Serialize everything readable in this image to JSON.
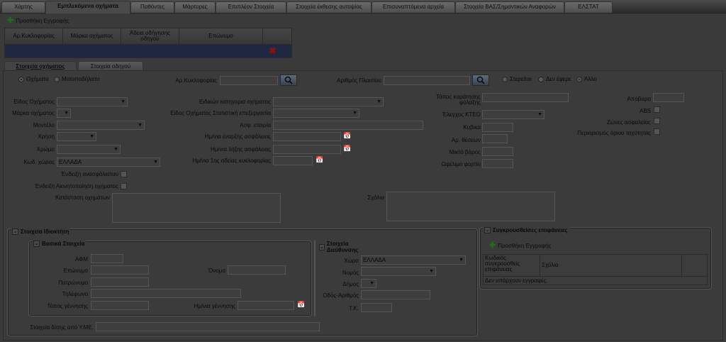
{
  "top_tabs": [
    {
      "label": "Χάρτης"
    },
    {
      "label": "Εμπλεκόμενα οχήματα"
    },
    {
      "label": "Παθόντες"
    },
    {
      "label": "Μάρτυρες"
    },
    {
      "label": "Επιπλέον Στοιχεία"
    },
    {
      "label": "Στοιχεία έκθεσης αυτοψίας"
    },
    {
      "label": "Επισυναπτόμενα αρχεία"
    },
    {
      "label": "Στοιχεία ΒΑΣ/Σημαντικών Αναφορών"
    },
    {
      "label": "ΕΛΣΤΑΤ"
    }
  ],
  "add_record_label": "Προσθήκη Εγγραφής",
  "grid": {
    "headers": [
      "Αρ.Κυκλοφορίας",
      "Μάρκα οχήματος",
      "Άδεια οδήγησης οδηγού",
      "Επώνυμο",
      ""
    ],
    "delete_icon": "✖"
  },
  "sub_tabs": [
    {
      "label": "Στοιχεία οχήματος"
    },
    {
      "label": "Στοιχεία οδηγού"
    }
  ],
  "vehicle_type": {
    "option1": "Οχήματα",
    "option2": "Μοτοποδήλατα",
    "selected": "Οχήματα"
  },
  "plate_label": "Αρ.Κυκλοφορίας",
  "chassis_label": "Αριθμός Πλαισίου",
  "status_radios": {
    "opt1": "Στερείται",
    "opt2": "Δεν έφερε",
    "opt3": "Άλλο",
    "selected": "Άλλο"
  },
  "col1": {
    "vehicle_kind": "Είδος Οχήματος",
    "brand": "Μάρκα οχήματος",
    "model": "Μοντέλο",
    "use": "Χρήση",
    "color": "Χρώμα",
    "country_code": "Κωδ. χώρας",
    "country_value": "ΕΛΛΑΔΑ",
    "uninsured": "Ένδειξη ανασφάλιστου",
    "immobilized": "Ένδειξη Ακινητοποίηση οχήματος",
    "condition": "Κατάσταση οχημάτων"
  },
  "col2": {
    "special_category": "Ειδικών κατηγορια οχήματος",
    "stat_kind": "Είδος Οχήματος Στατιστική επεξεργασία",
    "insurer": "Ασφ. εταιρία",
    "ins_start": "Ημ/νια έναρξης ασφάλειας",
    "ins_end": "Ημ/νια λήξης ασφάλειας",
    "first_license": "Ημ/νια 1ης αδείας κυκλοφορίας",
    "comments": "Σχόλια"
  },
  "col3": {
    "storage_place": "Τόπος καράτησης φύλαξης",
    "ktep": "Έλεγχος ΚΤΕΟ",
    "cc": "Κυβικά",
    "seats": "Αρ. θέσεων",
    "gross_weight": "Μικτό βάρος",
    "payload": "Ωφέλιμο φορτίο"
  },
  "col4": {
    "tare": "Απόβαρο",
    "abs": "ABS",
    "safety_zones": "Ζώνες ασφαλείας",
    "speed_limiter": "Περιορισμός όριου ταχύτητας"
  },
  "owner": {
    "title": "Στοιχεία Ιδιοκτήτη",
    "basic": {
      "title": "Βασικά Στοιχεία",
      "afm": "ΑΦΜ",
      "surname": "Επώνυμο",
      "name": "Όνομα",
      "father": "Πατρώνυμο",
      "phone": "Τηλέφωνο",
      "birthplace": "Τόπος γέννησης",
      "birthdate": "Ημ/νια γέννησης"
    },
    "address": {
      "title": "Στοιχεία Διεύθυνσης",
      "country": "Χώρα",
      "country_value": "ΕΛΛΑΔΑ",
      "prefecture": "Νομός",
      "municipality": "Δήμος",
      "street": "Οδός-Αριθμός",
      "zip": "Τ.Κ."
    },
    "yme": "Στοιχεία δ/σης από Υ.ΜΕ."
  },
  "surfaces": {
    "title": "Συγκρουσθείσες επιφάνειες",
    "add": "Προσθήκη Εγγραφής",
    "col1": "Κωδικός συγκρουσθείς επιφάνειας",
    "col2": "Σχόλια",
    "empty": "Δεν υπάρχουν εγγραφές."
  }
}
